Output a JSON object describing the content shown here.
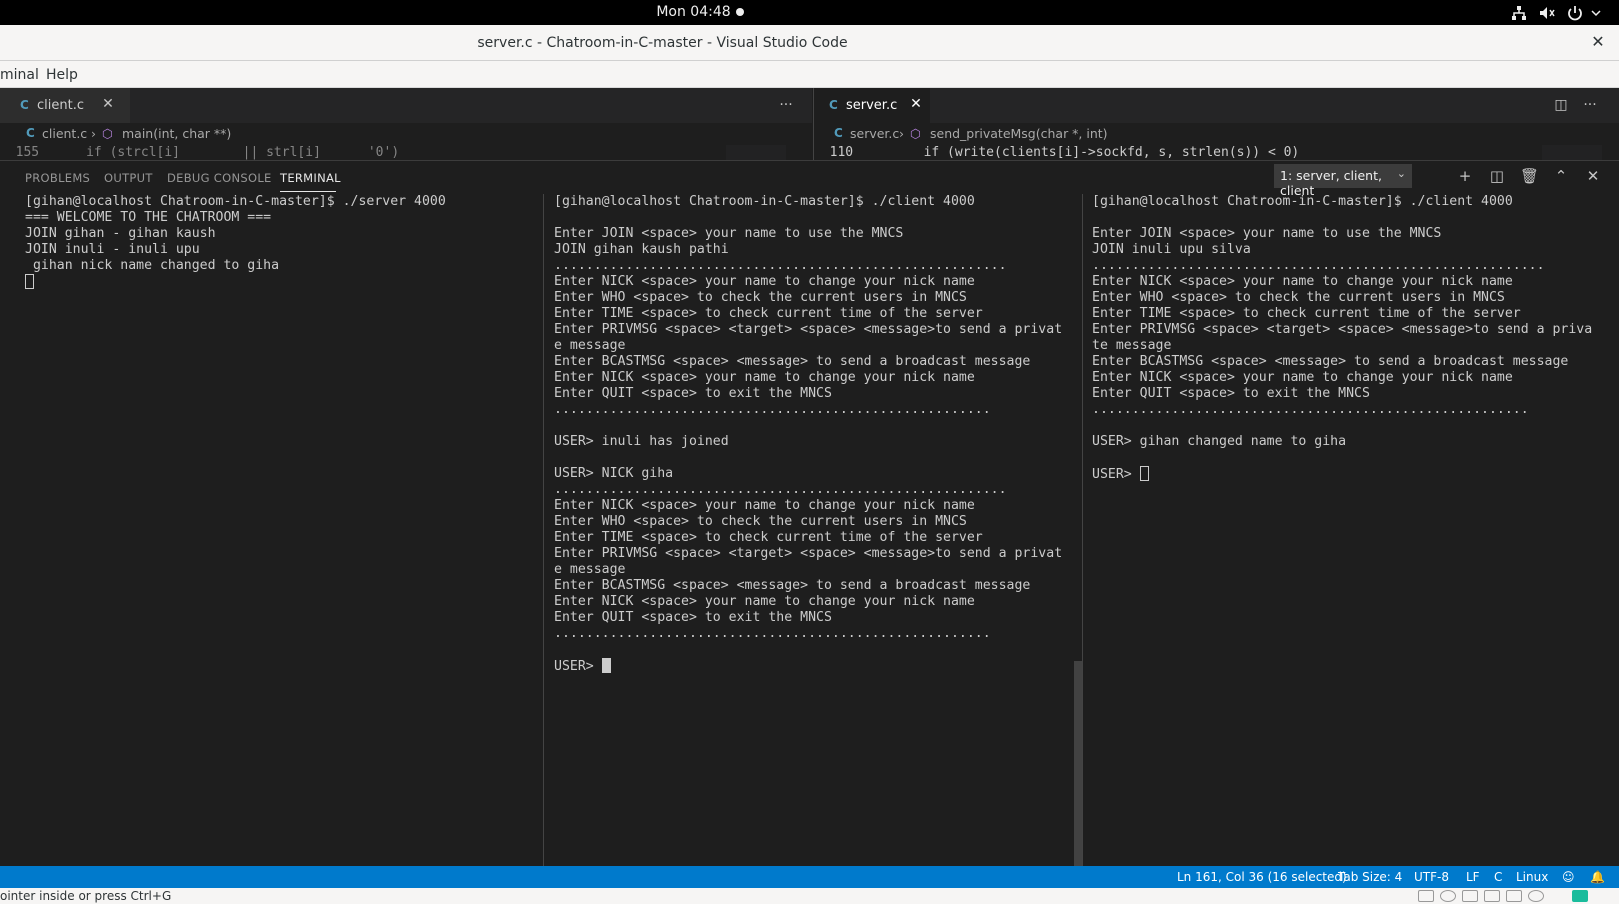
{
  "top_bar": {
    "clock": "Mon 04:48"
  },
  "window": {
    "title": "server.c - Chatroom-in-C-master - Visual Studio Code"
  },
  "menu": {
    "items": [
      "minal",
      "Help"
    ]
  },
  "editor": {
    "left_group": {
      "tab_icon": "C",
      "tab_label": "client.c",
      "breadcrumb_file": "client.c",
      "breadcrumb_symbol": "main(int, char **)",
      "code_peek": "  155      if (strcl[i]        || strl[i]      '0')"
    },
    "right_group": {
      "tab_icon": "C",
      "tab_label": "server.c",
      "breadcrumb_file": "server.c",
      "breadcrumb_symbol": "send_privateMsg(char *, int)",
      "code_peek": "  110         if (write(clients[i]->sockfd, s, strlen(s)) < 0)"
    }
  },
  "panel": {
    "tabs": [
      "PROBLEMS",
      "OUTPUT",
      "DEBUG CONSOLE",
      "TERMINAL"
    ],
    "active_tab": "TERMINAL",
    "terminal_selector": "1: server, client, client",
    "terminals": {
      "server": [
        "[gihan@localhost Chatroom-in-C-master]$ ./server 4000",
        "=== WELCOME TO THE CHATROOM ===",
        "JOIN gihan - gihan kaush",
        "JOIN inuli - inuli upu",
        " gihan nick name changed to giha"
      ],
      "client1": [
        "[gihan@localhost Chatroom-in-C-master]$ ./client 4000",
        "",
        "Enter JOIN <space> your name to use the MNCS",
        "JOIN gihan kaush pathi",
        ".........................................................",
        "Enter NICK <space> your name to change your nick name",
        "Enter WHO <space> to check the current users in MNCS",
        "Enter TIME <space> to check current time of the server",
        "Enter PRIVMSG <space> <target> <space> <message>to send a privat",
        "e message",
        "Enter BCASTMSG <space> <message> to send a broadcast message",
        "Enter NICK <space> your name to change your nick name",
        "Enter QUIT <space> to exit the MNCS",
        ".......................................................",
        "",
        "USER> inuli has joined",
        "",
        "USER> NICK giha",
        ".........................................................",
        "Enter NICK <space> your name to change your nick name",
        "Enter WHO <space> to check the current users in MNCS",
        "Enter TIME <space> to check current time of the server",
        "Enter PRIVMSG <space> <target> <space> <message>to send a privat",
        "e message",
        "Enter BCASTMSG <space> <message> to send a broadcast message",
        "Enter NICK <space> your name to change your nick name",
        "Enter QUIT <space> to exit the MNCS",
        ".......................................................",
        ""
      ],
      "client1_prompt": "USER> ",
      "client2": [
        "[gihan@localhost Chatroom-in-C-master]$ ./client 4000",
        "",
        "Enter JOIN <space> your name to use the MNCS",
        "JOIN inuli upu silva",
        ".........................................................",
        "Enter NICK <space> your name to change your nick name",
        "Enter WHO <space> to check the current users in MNCS",
        "Enter TIME <space> to check current time of the server",
        "Enter PRIVMSG <space> <target> <space> <message>to send a priva",
        "te message",
        "Enter BCASTMSG <space> <message> to send a broadcast message",
        "Enter NICK <space> your name to change your nick name",
        "Enter QUIT <space> to exit the MNCS",
        ".......................................................",
        "",
        "USER> gihan changed name to giha",
        ""
      ],
      "client2_prompt": "USER> "
    }
  },
  "status_bar": {
    "position": "Ln 161, Col 36 (16 selected)",
    "tab_size": "Tab Size: 4",
    "encoding": "UTF-8",
    "eol": "LF",
    "language": "C",
    "platform": "Linux"
  },
  "hint_bar": {
    "text": "ointer inside or press Ctrl+G"
  },
  "colors": {
    "status_bar": "#007acc",
    "editor_bg": "#1e1e1e",
    "terminal_text": "#cccccc",
    "c_icon": "#519aba"
  }
}
